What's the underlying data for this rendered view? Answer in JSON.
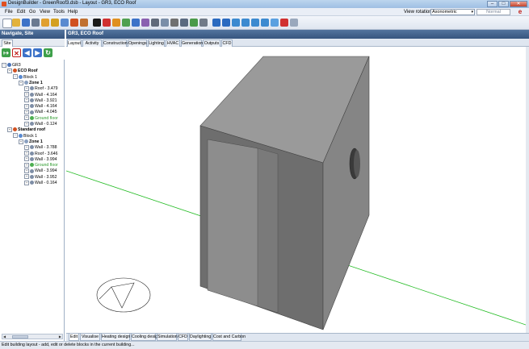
{
  "window": {
    "title": "DesignBuilder - GreenRoof3.dsb - Layout - GR3, ECO Roof",
    "buttons": {
      "minimize": "–",
      "maximize": "□",
      "close": "✕"
    }
  },
  "menu": [
    "File",
    "Edit",
    "Go",
    "View",
    "Tools",
    "Help"
  ],
  "view_rotation": {
    "label": "View rotation",
    "value": "Axonometric",
    "mode": "Normal"
  },
  "left_panel": {
    "title": "Navigate, Site",
    "tab": "Site",
    "tree": [
      {
        "label": "GR3",
        "level": 0,
        "icon": "site-icon",
        "color": "#4a74b8",
        "bold": false
      },
      {
        "label": "ECO Roof",
        "level": 1,
        "icon": "building-icon",
        "color": "#d05020",
        "bold": true
      },
      {
        "label": "Block 1",
        "level": 2,
        "icon": "block-icon",
        "color": "#5a8ad0",
        "bold": false
      },
      {
        "label": "Zone 1",
        "level": 3,
        "icon": "zone-icon",
        "color": "#8aa0c0",
        "bold": true
      },
      {
        "label": "Roof - 3.479",
        "level": 4,
        "icon": "surface-icon",
        "color": "#7e8ea6",
        "bold": false
      },
      {
        "label": "Wall - 4.164",
        "level": 4,
        "icon": "surface-icon",
        "color": "#7e8ea6",
        "bold": false
      },
      {
        "label": "Wall - 3.921",
        "level": 4,
        "icon": "surface-icon",
        "color": "#7e8ea6",
        "bold": false
      },
      {
        "label": "Wall - 4.164",
        "level": 4,
        "icon": "surface-icon",
        "color": "#7e8ea6",
        "bold": false
      },
      {
        "label": "Wall - 4.045",
        "level": 4,
        "icon": "surface-icon",
        "color": "#7e8ea6",
        "bold": false
      },
      {
        "label": "Ground floor",
        "level": 4,
        "icon": "surface-icon",
        "color": "#4caf50",
        "bold": false,
        "green": true
      },
      {
        "label": "Wall - 0.124",
        "level": 4,
        "icon": "surface-icon",
        "color": "#7e8ea6",
        "bold": false
      },
      {
        "label": "Standard roof",
        "level": 1,
        "icon": "building-icon",
        "color": "#d05020",
        "bold": true
      },
      {
        "label": "Block 1",
        "level": 2,
        "icon": "block-icon",
        "color": "#5a8ad0",
        "bold": false
      },
      {
        "label": "Zone 1",
        "level": 3,
        "icon": "zone-icon",
        "color": "#8aa0c0",
        "bold": true
      },
      {
        "label": "Wall - 3.788",
        "level": 4,
        "icon": "surface-icon",
        "color": "#7e8ea6",
        "bold": false
      },
      {
        "label": "Roof - 3.646",
        "level": 4,
        "icon": "surface-icon",
        "color": "#7e8ea6",
        "bold": false
      },
      {
        "label": "Wall - 3.994",
        "level": 4,
        "icon": "surface-icon",
        "color": "#7e8ea6",
        "bold": false
      },
      {
        "label": "Ground floor",
        "level": 4,
        "icon": "surface-icon",
        "color": "#4caf50",
        "bold": false,
        "green": true
      },
      {
        "label": "Wall - 3.994",
        "level": 4,
        "icon": "surface-icon",
        "color": "#7e8ea6",
        "bold": false
      },
      {
        "label": "Wall - 3.952",
        "level": 4,
        "icon": "surface-icon",
        "color": "#7e8ea6",
        "bold": false
      },
      {
        "label": "Wall - 0.164",
        "level": 4,
        "icon": "surface-icon",
        "color": "#7e8ea6",
        "bold": false
      }
    ]
  },
  "main": {
    "title": "GR3, ECO Roof",
    "top_tabs": [
      "Layout",
      "Activity",
      "Construction",
      "Openings",
      "Lighting",
      "HVAC",
      "Generation",
      "Outputs",
      "CFD"
    ],
    "active_top_tab": "Layout",
    "bottom_tabs": [
      "Edit",
      "Visualise",
      "Heating design",
      "Cooling design",
      "Simulation",
      "CFD",
      "Daylighting",
      "Cost and Carbon"
    ],
    "active_bottom_tab": "Edit"
  },
  "status": "Edit building layout - add, edit or delete blocks in the current building...",
  "toolbar_icons": [
    "new-file-icon",
    "open-file-icon",
    "save-icon",
    "print-icon",
    "wizard-icon",
    "pencil-icon",
    "measure-icon",
    "move-icon",
    "copy-icon",
    "select-arrow-icon",
    "draw-block-icon",
    "draw-zone-icon",
    "add-window-icon",
    "add-door-icon",
    "rotate-icon",
    "mirror-icon",
    "stretch-icon",
    "offset-icon",
    "split-icon",
    "merge-icon",
    "delete-icon",
    "undo-icon",
    "redo-icon",
    "zoom-in-icon",
    "zoom-out-icon",
    "zoom-fit-icon",
    "pan-icon",
    "grid-icon",
    "snap-icon",
    "help-toolbar-icon"
  ]
}
